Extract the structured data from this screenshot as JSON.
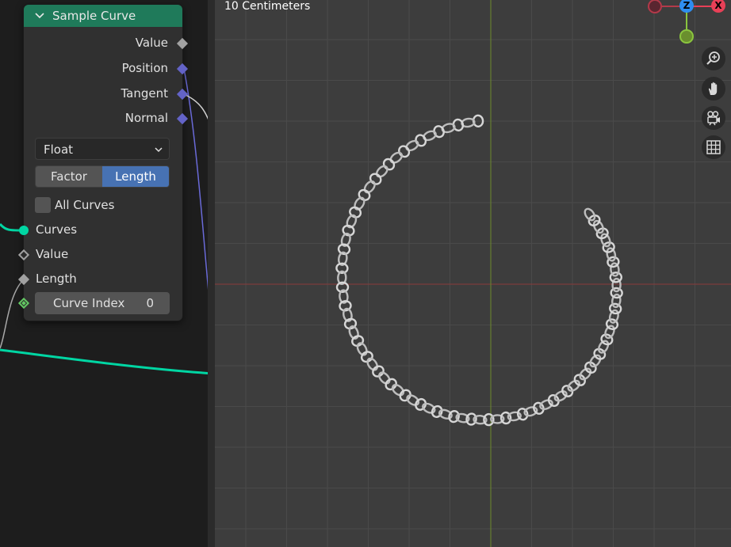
{
  "node": {
    "title": "Sample Curve",
    "outputs": [
      "Value",
      "Position",
      "Tangent",
      "Normal"
    ],
    "data_type": "Float",
    "mode_options": [
      "Factor",
      "Length"
    ],
    "mode_selected": "Length",
    "all_curves_label": "All Curves",
    "all_curves_checked": false,
    "inputs": [
      "Curves",
      "Value",
      "Length"
    ],
    "curve_index_label": "Curve Index",
    "curve_index_value": "0",
    "header_color": "#1f7a5a"
  },
  "viewport": {
    "scale_label": "10 Centimeters",
    "gizmo": {
      "z_label": "Z",
      "x_label": "X"
    },
    "nav_icons": [
      "zoom-icon",
      "hand-pan-icon",
      "camera-icon",
      "grid-icon"
    ]
  },
  "colors": {
    "accent": "#4772b3",
    "curve_socket": "#00d6a3",
    "vector_socket": "#6363c7",
    "x_axis": "#e84057",
    "y_axis": "#8ac43f",
    "z_axis": "#2e8ef0"
  }
}
